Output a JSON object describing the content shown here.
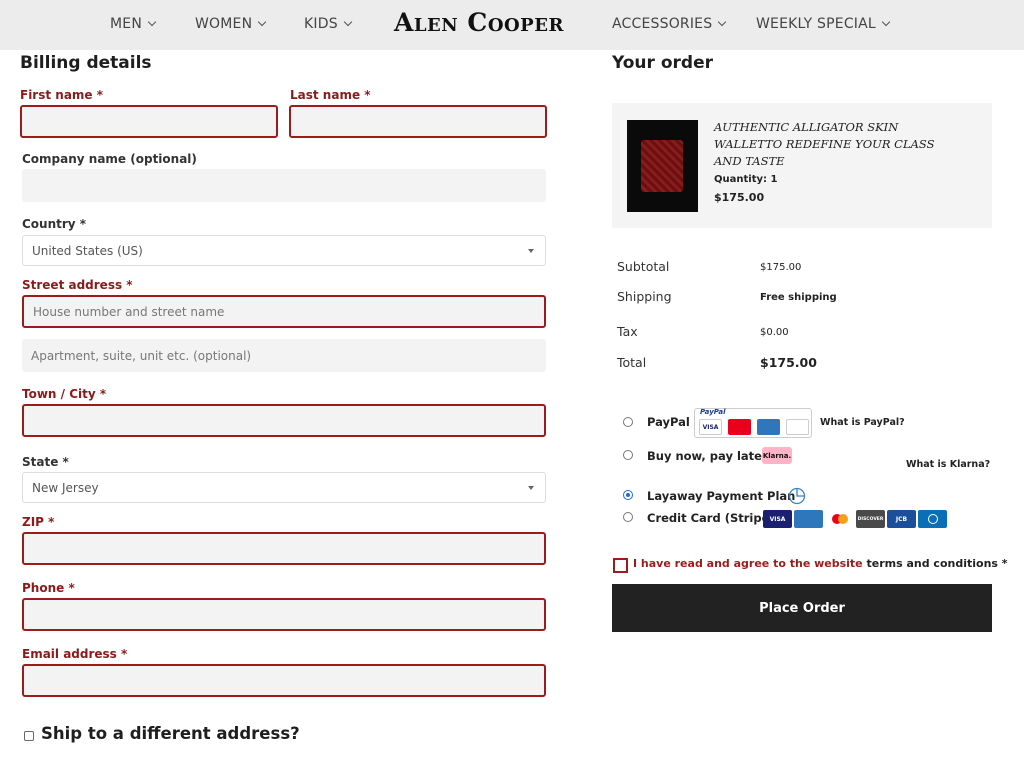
{
  "nav": {
    "items_left": [
      "MEN",
      "WOMEN",
      "KIDS"
    ],
    "logo": "Alen Cooper",
    "items_right": [
      "ACCESSORIES",
      "WEEKLY SPECIAL"
    ]
  },
  "billing": {
    "title": "Billing details",
    "first_name_label": "First name *",
    "last_name_label": "Last name *",
    "company_label": "Company name (optional)",
    "country_label": "Country *",
    "country_value": "United States (US)",
    "street_label": "Street address *",
    "street_placeholder": "House number and street name",
    "apartment_placeholder": "Apartment, suite, unit etc. (optional)",
    "city_label": "Town / City *",
    "state_label": "State *",
    "state_value": "New Jersey",
    "zip_label": "ZIP *",
    "phone_label": "Phone *",
    "email_label": "Email address *",
    "ship_different": "Ship to a different address?"
  },
  "order": {
    "title": "Your order",
    "product_title": "Authentic Alligator Skin Walletto Redefine Your Class and Taste",
    "product_qty": "Quantity: 1",
    "product_price": "$175.00",
    "subtotal_label": "Subtotal",
    "subtotal_value": "$175.00",
    "shipping_label": "Shipping",
    "shipping_value": "Free shipping",
    "tax_label": "Tax",
    "tax_value": "$0.00",
    "total_label": "Total",
    "total_value": "$175.00"
  },
  "payment": {
    "paypal_label": "PayPal",
    "paypal_logo": "PayPal",
    "paypal_link": "What is PayPal?",
    "klarna_label": "Buy now, pay later",
    "klarna_logo": "Klarna.",
    "klarna_link": "What is Klarna?",
    "layaway_label": "Layaway Payment Plan",
    "stripe_label": "Credit Card (Stripe)",
    "selected": "Layaway Payment Plan",
    "card_visa": "VISA",
    "card_mc": "MasterCard",
    "card_discover": "DISCOVER",
    "card_amex": "AMERICAN EXPRESS",
    "card_jcb": "JCB"
  },
  "terms": {
    "text_red": "I have read and agree to the website",
    "text_dark": "terms and conditions",
    "asterisk": "*"
  },
  "place_order": "Place Order",
  "colors": {
    "error": "#9e1b1b",
    "dark": "#222222",
    "nav_bg": "#ececec",
    "field_bg": "#f3f3f3"
  }
}
